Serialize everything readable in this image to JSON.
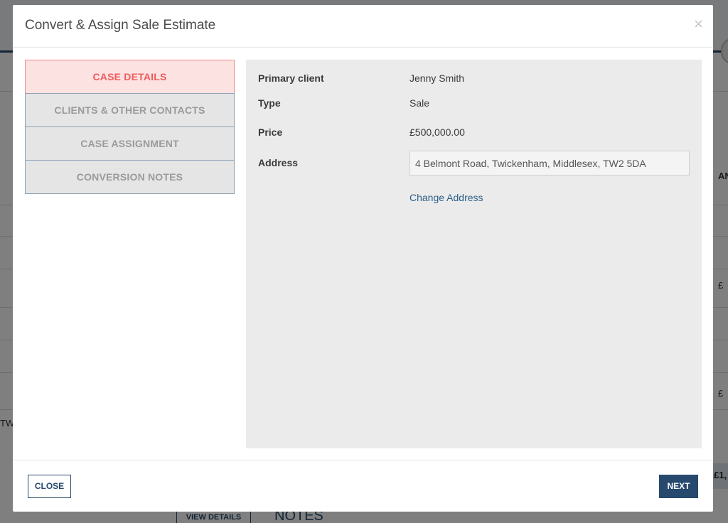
{
  "background": {
    "right_header_fragment": "AN",
    "right_value_1": "£",
    "right_value_2": "£",
    "left_fragment": "TW",
    "right_total_fragment": "£1,",
    "view_details_label": "VIEW DETAILS",
    "notes_heading": "NOTES"
  },
  "modal": {
    "title": "Convert & Assign Sale Estimate",
    "close_icon": "×",
    "tabs": [
      {
        "label": "CASE DETAILS",
        "active": true
      },
      {
        "label": "CLIENTS & OTHER CONTACTS",
        "active": false
      },
      {
        "label": "CASE ASSIGNMENT",
        "active": false
      },
      {
        "label": "CONVERSION NOTES",
        "active": false
      }
    ],
    "details": {
      "primary_client_label": "Primary client",
      "primary_client_value": "Jenny Smith",
      "type_label": "Type",
      "type_value": "Sale",
      "price_label": "Price",
      "price_value": "£500,000.00",
      "address_label": "Address",
      "address_value": "4 Belmont Road, Twickenham, Middlesex, TW2 5DA",
      "change_address_link": "Change Address"
    },
    "footer": {
      "close_label": "CLOSE",
      "next_label": "NEXT"
    }
  },
  "colors": {
    "accent": "#27496d",
    "active_tab_text": "#ef5b5b",
    "active_tab_bg": "#fde2e2",
    "panel_bg": "#ebebeb",
    "link": "#2b5f8a"
  }
}
